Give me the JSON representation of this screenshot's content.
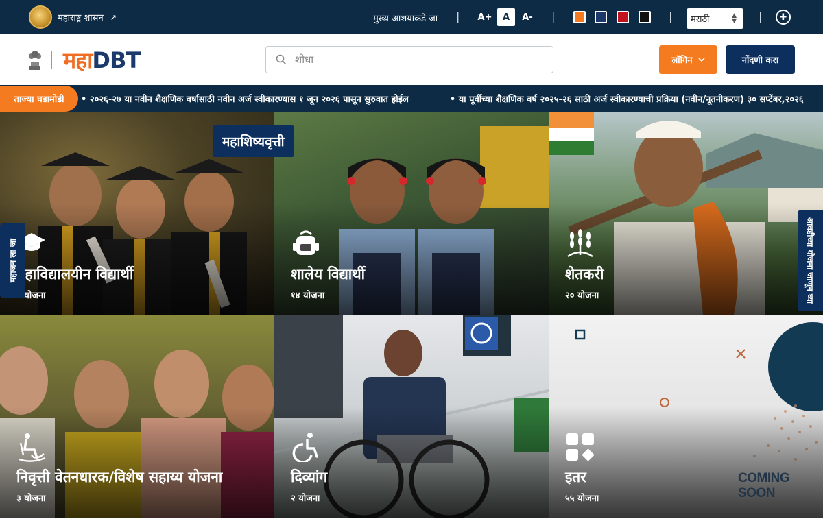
{
  "topbar": {
    "gov_label": "महाराष्ट्र शासन",
    "skip_label": "मुख्य आशयाकडे जा",
    "font_increase": "A+",
    "font_normal": "A",
    "font_decrease": "A-",
    "themes": [
      "#f47b20",
      "#1b3a6b",
      "#c1121f",
      "#111111"
    ],
    "language": "मराठी"
  },
  "header": {
    "brand_part1": "महा",
    "brand_part2": "DBT",
    "search_placeholder": "शोधा",
    "login_label": "लॉगिन",
    "register_label": "नोंदणी करा"
  },
  "ticker": {
    "label": "ताज्या घडामोडी",
    "items": [
      "२०२६-२७ या नवीन शैक्षणिक वर्षासाठी नवीन अर्ज स्वीकारण्यास १ जून २०२६ पासून सुरुवात होईल",
      "या पूर्वीच्या शैक्षणिक वर्ष २०२५-२६ साठी अर्ज स्वीकारण्याची प्रक्रिया (नवीन/नूतनीकरण) ३० सप्टेंबर,२०२६"
    ]
  },
  "badge": "महाशिष्यवृत्ती",
  "side_left": "महाजन ला जा",
  "side_right": "आवडीच्या योजना जाणून घ्या",
  "tiles": [
    {
      "name": "महाविद्यालयीन विद्यार्थी",
      "count": "० योजना",
      "icon": "graduation-cap-icon"
    },
    {
      "name": "शालेय विद्यार्थी",
      "count": "१४ योजना",
      "icon": "school-bag-icon"
    },
    {
      "name": "शेतकरी",
      "count": "२० योजना",
      "icon": "wheat-icon"
    },
    {
      "name": "निवृत्ती वेतनधारक/विशेष सहाय्य योजना",
      "count": "३ योजना",
      "icon": "rocking-chair-icon"
    },
    {
      "name": "दिव्यांग",
      "count": "२ योजना",
      "icon": "wheelchair-icon"
    },
    {
      "name": "इतर",
      "count": "५५ योजना",
      "icon": "grid-shapes-icon"
    }
  ],
  "coming_soon": "COMING SOON"
}
